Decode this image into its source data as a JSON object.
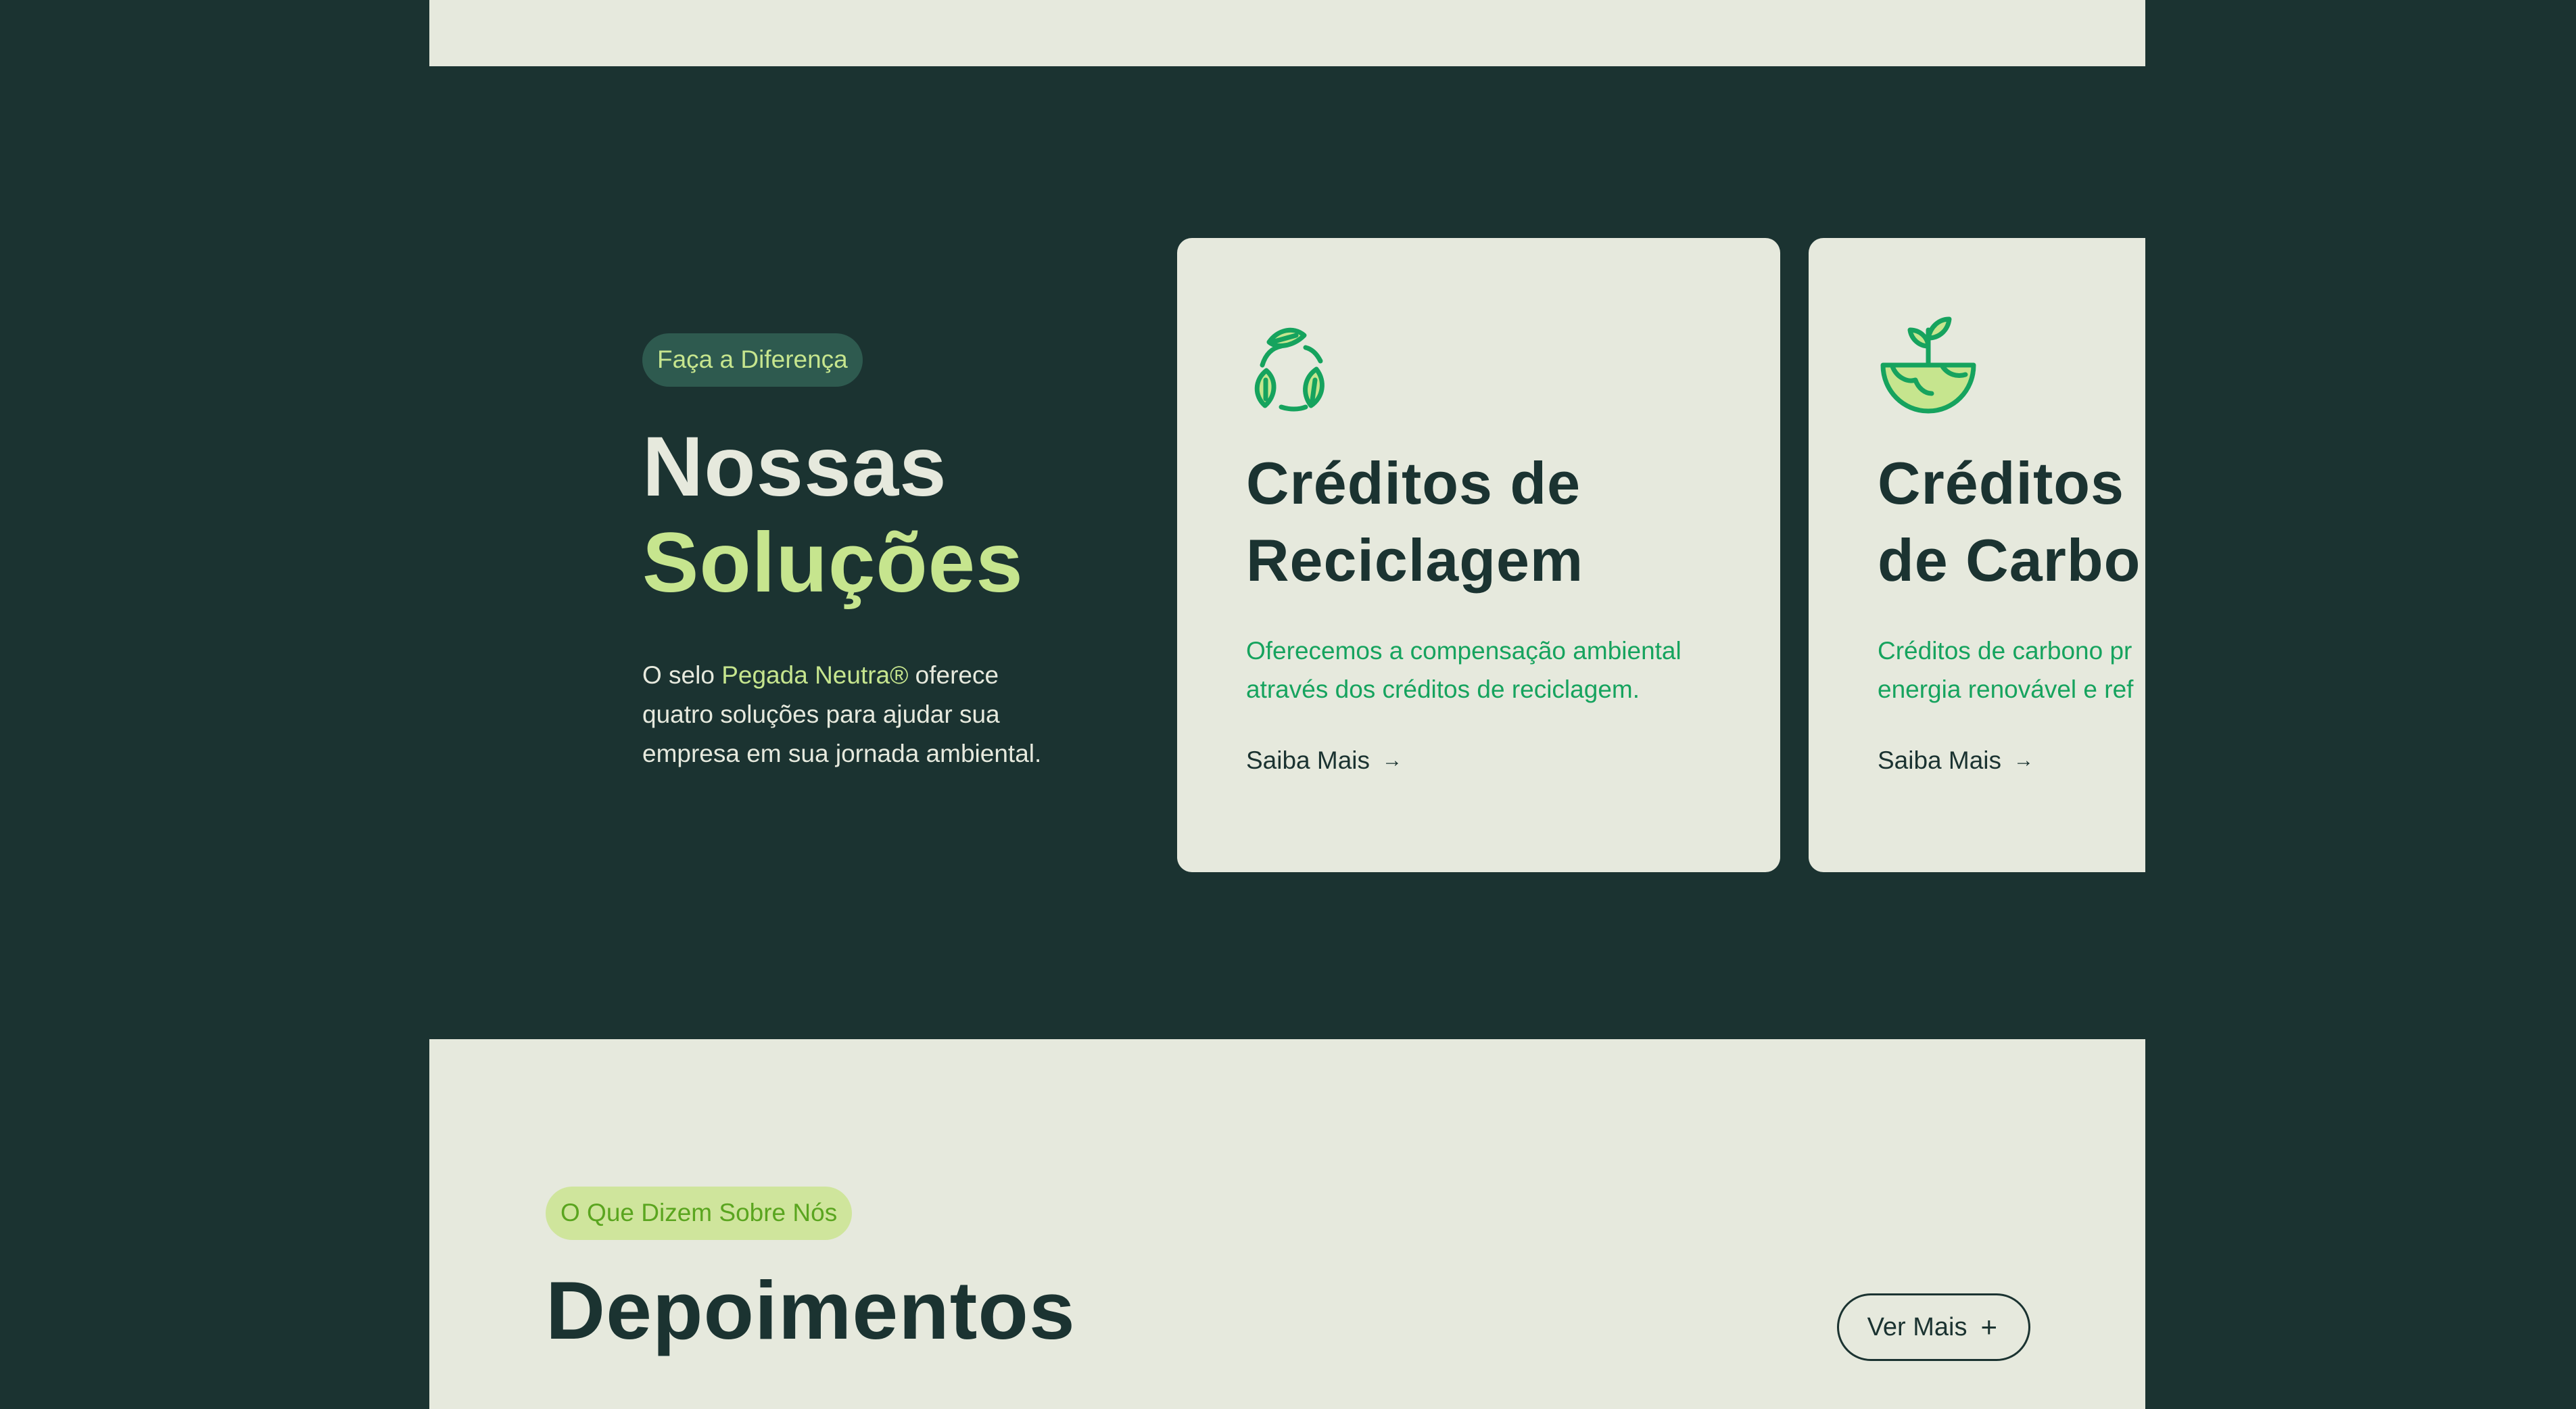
{
  "solutions": {
    "badge": "Faça a Diferença",
    "title_line1": "Nossas",
    "title_line2": "Soluções",
    "description_prefix": "O selo ",
    "description_highlight": "Pegada Neutra®",
    "description_suffix": " oferece quatro soluções para ajudar sua empresa em sua jornada ambiental.",
    "cards": [
      {
        "icon": "recycle-leaves-icon",
        "title_line1": "Créditos de",
        "title_line2": "Reciclagem",
        "text_line1": "Oferecemos a compensação ambiental",
        "text_line2": "através dos créditos de reciclagem.",
        "link_label": "Saiba Mais",
        "link_arrow": "→"
      },
      {
        "icon": "globe-sprout-icon",
        "title_line1": "Créditos",
        "title_line2": "de Carbo",
        "text_line1": "Créditos de carbono pr",
        "text_line2": "energia renovável e ref",
        "link_label": "Saiba Mais",
        "link_arrow": "→"
      }
    ]
  },
  "testimonials": {
    "badge": "O Que Dizem Sobre Nós",
    "title": "Depoimentos",
    "button_label": "Ver Mais",
    "button_icon": "+"
  },
  "colors": {
    "background_dark": "#1b3331",
    "surface_light": "#e6e9dd",
    "accent_lime": "#c6e58e",
    "accent_green": "#16a35e",
    "badge_dark": "#2e5a4f",
    "badge_light": "#cfe59c"
  }
}
